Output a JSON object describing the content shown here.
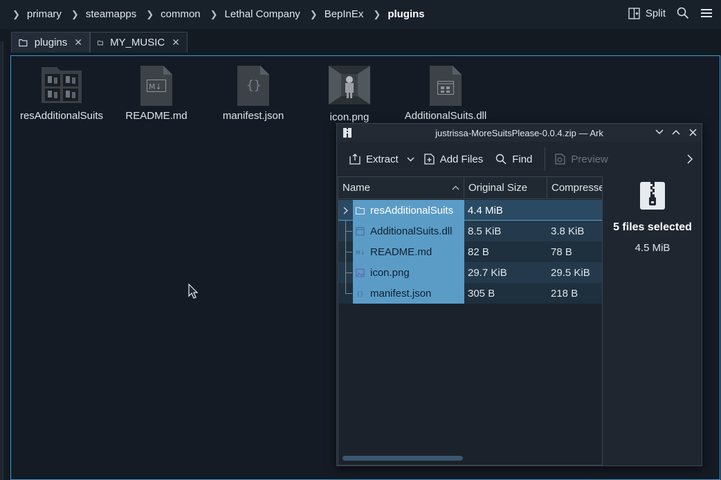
{
  "breadcrumb": {
    "segments": [
      "primary",
      "steamapps",
      "common",
      "Lethal Company",
      "BepInEx",
      "plugins"
    ]
  },
  "toolbar": {
    "split_label": "Split"
  },
  "tabs": [
    {
      "label": "plugins",
      "active": true
    },
    {
      "label": "MY_MUSIC",
      "active": false
    }
  ],
  "files": [
    {
      "name": "resAdditionalSuits",
      "icon": "folder-icon"
    },
    {
      "name": "README.md",
      "icon": "markdown-file-icon"
    },
    {
      "name": "manifest.json",
      "icon": "json-file-icon"
    },
    {
      "name": "icon.png",
      "icon": "image-thumbnail"
    },
    {
      "name": "AdditionalSuits.dll",
      "icon": "library-file-icon"
    }
  ],
  "ark": {
    "title": "justrissa-MoreSuitsPlease-0.0.4.zip — Ark",
    "toolbar": {
      "extract": "Extract",
      "add_files": "Add Files",
      "find": "Find",
      "preview": "Preview"
    },
    "columns": [
      "Name",
      "Original Size",
      "Compresse"
    ],
    "rows": [
      {
        "name": "resAdditionalSuits",
        "icon": "folder-icon",
        "original": "4.4 MiB",
        "compressed": ""
      },
      {
        "name": "AdditionalSuits.dll",
        "icon": "library-file-icon",
        "original": "8.5 KiB",
        "compressed": "3.8 KiB"
      },
      {
        "name": "README.md",
        "icon": "markdown-file-icon",
        "original": "82 B",
        "compressed": "78 B"
      },
      {
        "name": "icon.png",
        "icon": "image-file-icon",
        "original": "29.7 KiB",
        "compressed": "29.5 KiB"
      },
      {
        "name": "manifest.json",
        "icon": "json-file-icon",
        "original": "305 B",
        "compressed": "218 B"
      }
    ],
    "selection": {
      "label": "5 files selected",
      "size": "4.5 MiB"
    }
  },
  "colors": {
    "accent": "#3c9ad4",
    "selection": "#5b9cc7",
    "background": "#141b24"
  }
}
